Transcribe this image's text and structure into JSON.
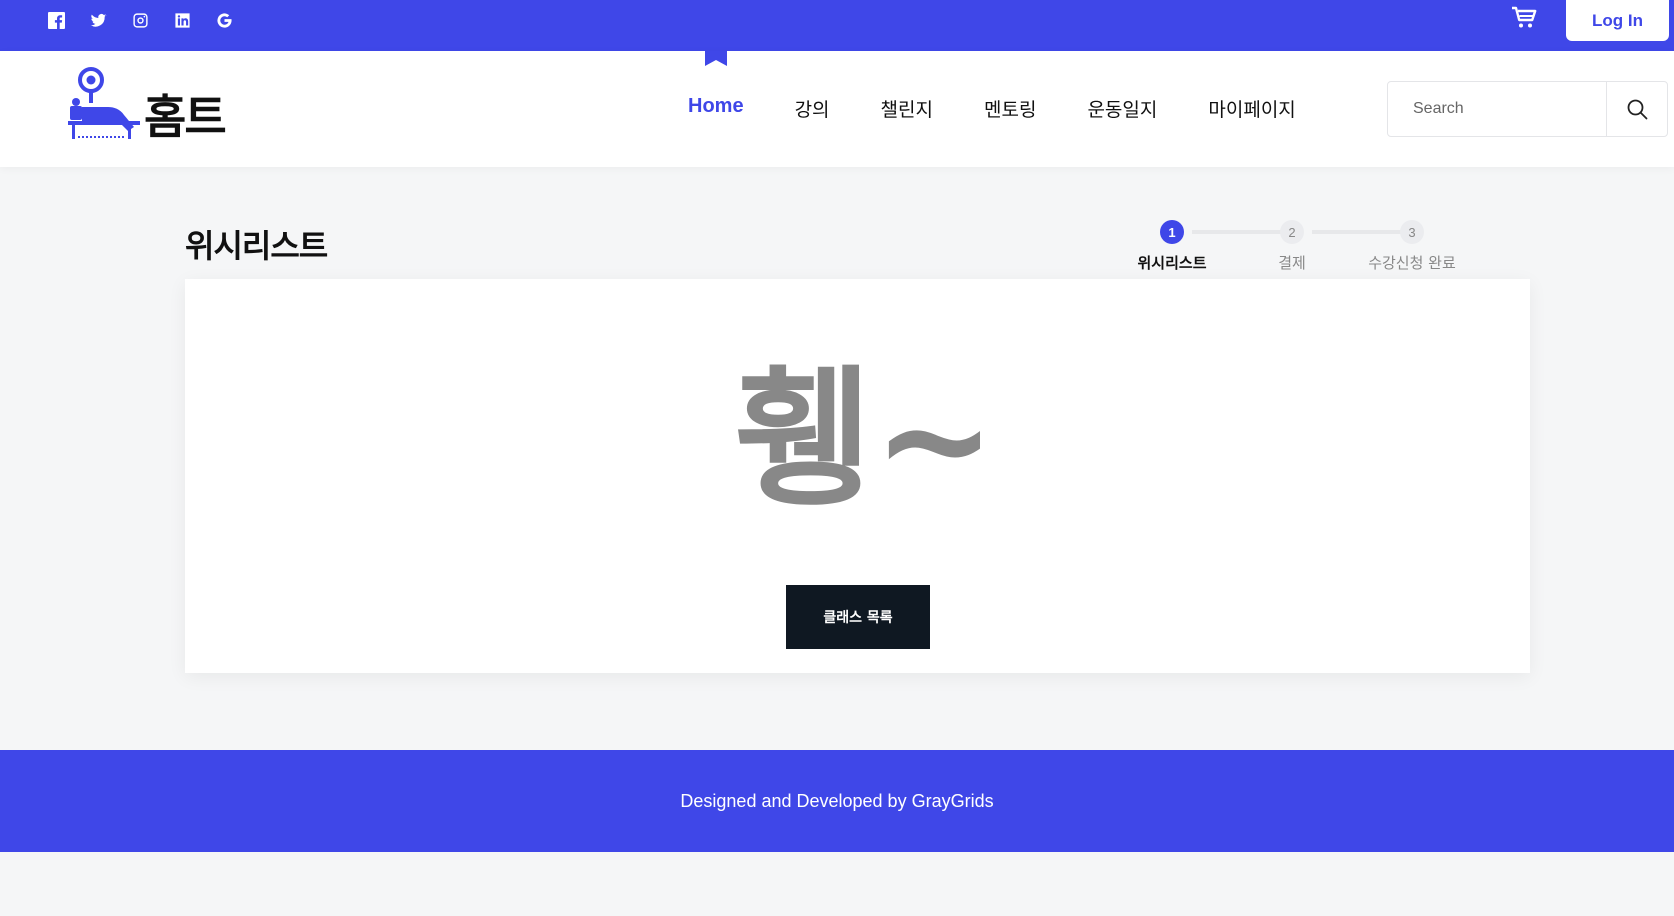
{
  "topbar": {
    "social_icons": [
      "facebook-icon",
      "twitter-icon",
      "instagram-icon",
      "linkedin-icon",
      "google-icon"
    ],
    "cart_icon": "cart-icon",
    "login_label": "Log In"
  },
  "brand": {
    "logo_text": "홈트"
  },
  "nav": {
    "items": [
      {
        "label": "Home",
        "active": true
      },
      {
        "label": "강의"
      },
      {
        "label": "챌린지"
      },
      {
        "label": "멘토링"
      },
      {
        "label": "운동일지"
      },
      {
        "label": "마이페이지"
      }
    ]
  },
  "search": {
    "placeholder": "Search",
    "icon": "search-icon"
  },
  "page": {
    "title": "위시리스트"
  },
  "steps": [
    {
      "number": "1",
      "label": "위시리스트",
      "active": true
    },
    {
      "number": "2",
      "label": "결제"
    },
    {
      "number": "3",
      "label": "수강신청 완료"
    }
  ],
  "empty_state": {
    "text": "휑~",
    "button_label": "클래스 목록"
  },
  "footer": {
    "text": "Designed and Developed by GrayGrids"
  },
  "colors": {
    "accent": "#3f47e8",
    "button_dark": "#0f1822",
    "empty_text": "#888888"
  }
}
